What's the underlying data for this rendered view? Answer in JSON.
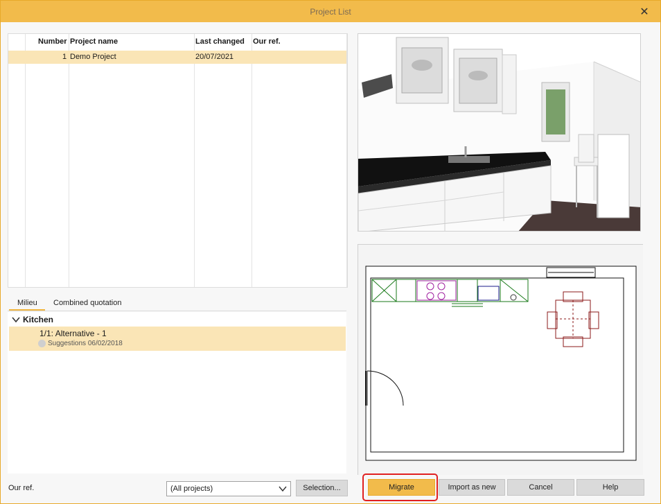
{
  "window": {
    "title": "Project List",
    "close_icon": "close-icon"
  },
  "table": {
    "columns": [
      "Number",
      "Project name",
      "Last changed",
      "Our ref."
    ],
    "rows": [
      {
        "number": "1",
        "name": "Demo Project",
        "changed": "20/07/2021",
        "ref": ""
      }
    ]
  },
  "tabs": {
    "milieu": "Milieu",
    "combined": "Combined quotation"
  },
  "tree": {
    "group": "Kitchen",
    "item_title": "1/1: Alternative - 1",
    "item_sub": "Suggestions 06/02/2018"
  },
  "bottom": {
    "our_ref_label": "Our ref.",
    "filter_value": "(All projects)",
    "selection": "Selection...",
    "migrate": "Migrate",
    "import": "Import as new",
    "cancel": "Cancel",
    "help": "Help"
  },
  "colors": {
    "accent": "#f2bb4b",
    "row_selected": "#fae5b6",
    "highlight": "#e02020"
  }
}
